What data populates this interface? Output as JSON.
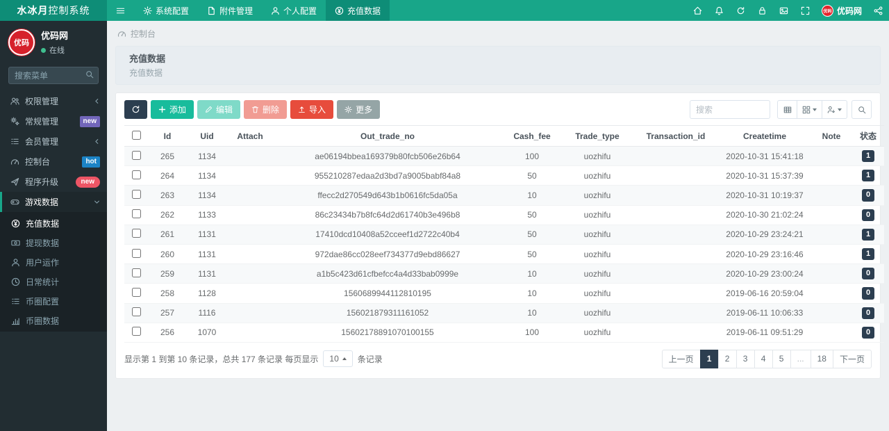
{
  "navbar": {
    "brand": {
      "bold": "水冰月",
      "normal": "控制系统"
    },
    "menu": [
      {
        "label": "系统配置"
      },
      {
        "label": "附件管理"
      },
      {
        "label": "个人配置"
      },
      {
        "label": "充值数据"
      }
    ],
    "logo_text": "优码网",
    "logo_abbr": "优码"
  },
  "sidebar": {
    "profile": {
      "name": "优码网",
      "status": "在线",
      "logo_abbr": "优码"
    },
    "search_placeholder": "搜索菜单",
    "items": [
      {
        "label": "权限管理"
      },
      {
        "label": "常规管理",
        "badge": "new"
      },
      {
        "label": "会员管理"
      },
      {
        "label": "控制台",
        "badge": "hot"
      },
      {
        "label": "程序升级",
        "badge": "new"
      },
      {
        "label": "游戏数据"
      }
    ],
    "submenu": [
      {
        "label": "充值数据"
      },
      {
        "label": "提现数据"
      },
      {
        "label": "用户运作"
      },
      {
        "label": "日常统计"
      },
      {
        "label": "币圈配置"
      },
      {
        "label": "币圈数据"
      }
    ]
  },
  "breadcrumb": {
    "label": "控制台"
  },
  "page_header": {
    "title": "充值数据",
    "subtitle": "充值数据"
  },
  "toolbar": {
    "add": "添加",
    "edit": "编辑",
    "delete": "删除",
    "import": "导入",
    "more": "更多",
    "search_placeholder": "搜索"
  },
  "table": {
    "columns": [
      "Id",
      "Uid",
      "Attach",
      "Out_trade_no",
      "Cash_fee",
      "Trade_type",
      "Transaction_id",
      "Createtime",
      "Note",
      "状态"
    ],
    "rows": [
      {
        "id": "265",
        "uid": "1134",
        "attach": "",
        "out_trade_no": "ae06194bbea169379b80fcb506e26b64",
        "cash_fee": "100",
        "trade_type": "uozhifu",
        "transaction_id": "",
        "createtime": "2020-10-31 15:41:18",
        "note": "",
        "status": "1"
      },
      {
        "id": "264",
        "uid": "1134",
        "attach": "",
        "out_trade_no": "955210287edaa2d3bd7a9005babf84a8",
        "cash_fee": "50",
        "trade_type": "uozhifu",
        "transaction_id": "",
        "createtime": "2020-10-31 15:37:39",
        "note": "",
        "status": "1"
      },
      {
        "id": "263",
        "uid": "1134",
        "attach": "",
        "out_trade_no": "ffecc2d270549d643b1b0616fc5da05a",
        "cash_fee": "10",
        "trade_type": "uozhifu",
        "transaction_id": "",
        "createtime": "2020-10-31 10:19:37",
        "note": "",
        "status": "0"
      },
      {
        "id": "262",
        "uid": "1133",
        "attach": "",
        "out_trade_no": "86c23434b7b8fc64d2d61740b3e496b8",
        "cash_fee": "50",
        "trade_type": "uozhifu",
        "transaction_id": "",
        "createtime": "2020-10-30 21:02:24",
        "note": "",
        "status": "0"
      },
      {
        "id": "261",
        "uid": "1131",
        "attach": "",
        "out_trade_no": "17410dcd10408a52cceef1d2722c40b4",
        "cash_fee": "50",
        "trade_type": "uozhifu",
        "transaction_id": "",
        "createtime": "2020-10-29 23:24:21",
        "note": "",
        "status": "1"
      },
      {
        "id": "260",
        "uid": "1131",
        "attach": "",
        "out_trade_no": "972dae86cc028eef734377d9ebd86627",
        "cash_fee": "50",
        "trade_type": "uozhifu",
        "transaction_id": "",
        "createtime": "2020-10-29 23:16:46",
        "note": "",
        "status": "1"
      },
      {
        "id": "259",
        "uid": "1131",
        "attach": "",
        "out_trade_no": "a1b5c423d61cfbefcc4a4d33bab0999e",
        "cash_fee": "10",
        "trade_type": "uozhifu",
        "transaction_id": "",
        "createtime": "2020-10-29 23:00:24",
        "note": "",
        "status": "0"
      },
      {
        "id": "258",
        "uid": "1128",
        "attach": "",
        "out_trade_no": "1560689944112810195",
        "cash_fee": "10",
        "trade_type": "uozhifu",
        "transaction_id": "",
        "createtime": "2019-06-16 20:59:04",
        "note": "",
        "status": "0"
      },
      {
        "id": "257",
        "uid": "1116",
        "attach": "",
        "out_trade_no": "156021879311161052",
        "cash_fee": "10",
        "trade_type": "uozhifu",
        "transaction_id": "",
        "createtime": "2019-06-11 10:06:33",
        "note": "",
        "status": "0"
      },
      {
        "id": "256",
        "uid": "1070",
        "attach": "",
        "out_trade_no": "15602178891070100155",
        "cash_fee": "100",
        "trade_type": "uozhifu",
        "transaction_id": "",
        "createtime": "2019-06-11 09:51:29",
        "note": "",
        "status": "0"
      }
    ]
  },
  "footer": {
    "summary_prefix": "显示第 1 到第 10 条记录，总共 177 条记录 每页显示",
    "page_size": "10",
    "summary_suffix": "条记录",
    "pages": {
      "prev": "上一页",
      "p1": "1",
      "p2": "2",
      "p3": "3",
      "p4": "4",
      "p5": "5",
      "ellipsis": "...",
      "p18": "18",
      "next": "下一页"
    }
  },
  "colors": {
    "navbar_green": "#18a689",
    "brand_dark_green": "#0e8d77",
    "sidebar_dark": "#222d32",
    "submenu_dark": "#1a2226",
    "primary_navy": "#2c3e50",
    "success_green": "#18bc9c",
    "danger_red": "#e74c3c",
    "default_gray": "#95a5a6",
    "badge_new_purple": "#7266ba",
    "badge_hot_blue": "#1c84c6",
    "badge_new_red": "#ed5565",
    "logo_red": "#d6212b",
    "online_dot_green": "#3fbf8f"
  }
}
